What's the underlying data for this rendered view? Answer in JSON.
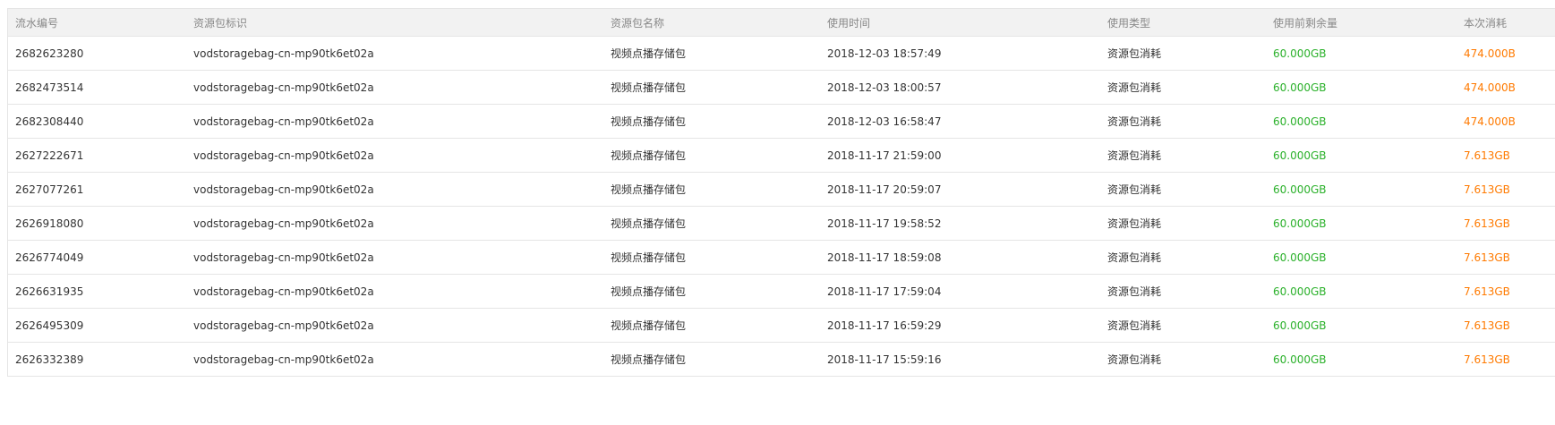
{
  "colors": {
    "remain": "#2bb12b",
    "consume": "#ff7a00",
    "header_bg": "#f2f2f2",
    "header_text": "#888888",
    "border": "#e5e5e5"
  },
  "table": {
    "headers": [
      "流水编号",
      "资源包标识",
      "资源包名称",
      "使用时间",
      "使用类型",
      "使用前剩余量",
      "本次消耗"
    ],
    "rows": [
      [
        "2682623280",
        "vodstoragebag-cn-mp90tk6et02a",
        "视频点播存储包",
        "2018-12-03 18:57:49",
        "资源包消耗",
        "60.000GB",
        "474.000B"
      ],
      [
        "2682473514",
        "vodstoragebag-cn-mp90tk6et02a",
        "视频点播存储包",
        "2018-12-03 18:00:57",
        "资源包消耗",
        "60.000GB",
        "474.000B"
      ],
      [
        "2682308440",
        "vodstoragebag-cn-mp90tk6et02a",
        "视频点播存储包",
        "2018-12-03 16:58:47",
        "资源包消耗",
        "60.000GB",
        "474.000B"
      ],
      [
        "2627222671",
        "vodstoragebag-cn-mp90tk6et02a",
        "视频点播存储包",
        "2018-11-17 21:59:00",
        "资源包消耗",
        "60.000GB",
        "7.613GB"
      ],
      [
        "2627077261",
        "vodstoragebag-cn-mp90tk6et02a",
        "视频点播存储包",
        "2018-11-17 20:59:07",
        "资源包消耗",
        "60.000GB",
        "7.613GB"
      ],
      [
        "2626918080",
        "vodstoragebag-cn-mp90tk6et02a",
        "视频点播存储包",
        "2018-11-17 19:58:52",
        "资源包消耗",
        "60.000GB",
        "7.613GB"
      ],
      [
        "2626774049",
        "vodstoragebag-cn-mp90tk6et02a",
        "视频点播存储包",
        "2018-11-17 18:59:08",
        "资源包消耗",
        "60.000GB",
        "7.613GB"
      ],
      [
        "2626631935",
        "vodstoragebag-cn-mp90tk6et02a",
        "视频点播存储包",
        "2018-11-17 17:59:04",
        "资源包消耗",
        "60.000GB",
        "7.613GB"
      ],
      [
        "2626495309",
        "vodstoragebag-cn-mp90tk6et02a",
        "视频点播存储包",
        "2018-11-17 16:59:29",
        "资源包消耗",
        "60.000GB",
        "7.613GB"
      ],
      [
        "2626332389",
        "vodstoragebag-cn-mp90tk6et02a",
        "视频点播存储包",
        "2018-11-17 15:59:16",
        "资源包消耗",
        "60.000GB",
        "7.613GB"
      ]
    ]
  }
}
